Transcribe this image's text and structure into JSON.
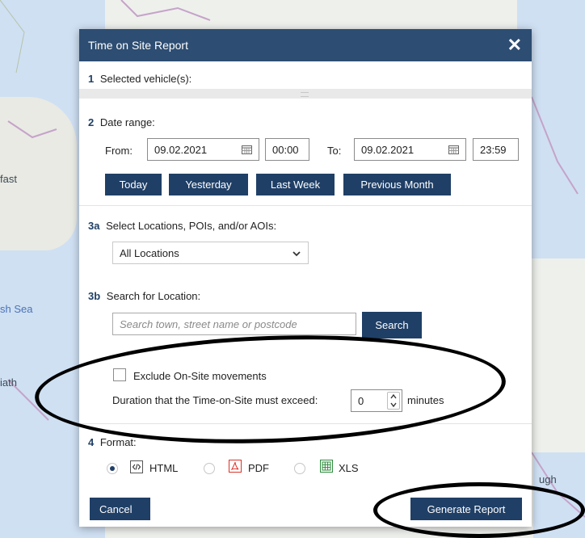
{
  "map": {
    "labels": [
      "fast",
      "sh Sea",
      "iath",
      "ugh"
    ]
  },
  "dialog": {
    "title": "Time on Site Report",
    "close_glyph": "✕",
    "section1": {
      "num": "1",
      "title": "Selected vehicle(s):"
    },
    "section2": {
      "num": "2",
      "title": "Date range:",
      "from_label": "From:",
      "from_date": "09.02.2021",
      "from_time": "00:00",
      "to_label": "To:",
      "to_date": "09.02.2021",
      "to_time": "23:59",
      "quick_buttons": [
        "Today",
        "Yesterday",
        "Last Week",
        "Previous Month"
      ]
    },
    "section3a": {
      "num": "3a",
      "title": "Select Locations, POIs, and/or AOIs:",
      "selected": "All Locations"
    },
    "section3b": {
      "num": "3b",
      "title": "Search for Location:",
      "placeholder": "Search town, street name or postcode",
      "search_label": "Search"
    },
    "options": {
      "exclude_label": "Exclude On-Site movements",
      "exclude_checked": false,
      "duration_label": "Duration that the Time-on-Site must exceed:",
      "duration_value": "0",
      "duration_unit": "minutes"
    },
    "section4": {
      "num": "4",
      "title": "Format:",
      "formats": [
        {
          "label": "HTML",
          "icon": "html-file-icon",
          "selected": true
        },
        {
          "label": "PDF",
          "icon": "pdf-file-icon",
          "selected": false
        },
        {
          "label": "XLS",
          "icon": "xls-file-icon",
          "selected": false
        }
      ]
    },
    "footer": {
      "cancel_label": "Cancel",
      "generate_label": "Generate Report"
    }
  },
  "colors": {
    "header": "#2d4d72",
    "button": "#1f3f66",
    "sea": "#cfe0f3",
    "pdf": "#d9342b",
    "xls": "#2e8b3c"
  }
}
